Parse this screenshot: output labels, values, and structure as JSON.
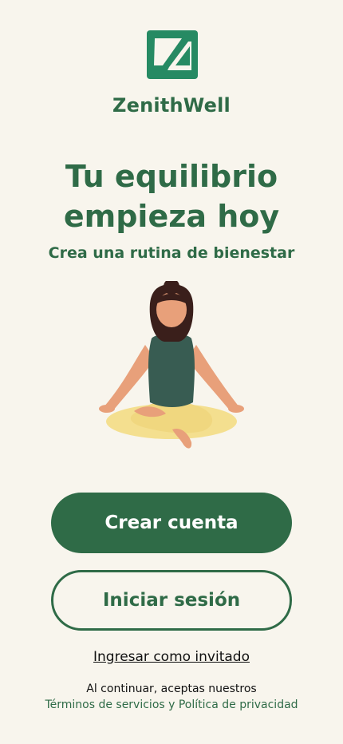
{
  "brand": {
    "name": "ZenithWell",
    "icon": "zenithwell-logo"
  },
  "hero": {
    "title_line1": "Tu equilibrio",
    "title_line2": "empieza hoy",
    "subtitle": "Crea una rutina de bienestar",
    "illustration": "meditating-woman-illustration"
  },
  "actions": {
    "create_account": "Crear cuenta",
    "sign_in": "Iniciar sesión",
    "guest": "Ingresar como invitado"
  },
  "legal": {
    "prefix": "Al continuar, aceptas nuestros",
    "link": "Términos de servicios y Política de privacidad"
  },
  "colors": {
    "background": "#f8f5ed",
    "primary": "#2f6b47",
    "logo_green": "#268a63"
  }
}
